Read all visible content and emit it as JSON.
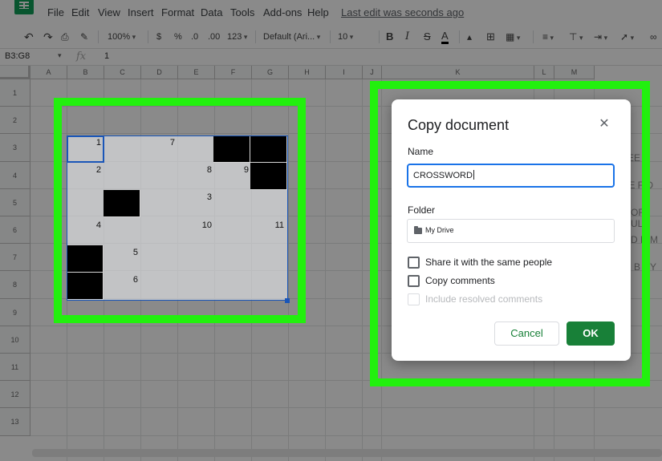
{
  "menubar": {
    "items": [
      "File",
      "Edit",
      "View",
      "Insert",
      "Format",
      "Data",
      "Tools",
      "Add-ons",
      "Help"
    ],
    "last_edit": "Last edit was seconds ago"
  },
  "toolbar": {
    "zoom": "100%",
    "currency": "$",
    "percent": "%",
    "decrease_decimals": ".0",
    "increase_decimals": ".00",
    "more_formats": "123",
    "font": "Default (Ari...",
    "font_size": "10",
    "bold": "B",
    "italic": "I",
    "strikethrough": "S",
    "text_color": "A"
  },
  "formula_bar": {
    "cell_range": "B3:G8",
    "fx": "fx",
    "value": "1"
  },
  "grid": {
    "columns": [
      "A",
      "B",
      "C",
      "D",
      "E",
      "F",
      "G",
      "H",
      "I",
      "J",
      "K",
      "L",
      "M"
    ],
    "rows": [
      "1",
      "2",
      "3",
      "4",
      "5",
      "6",
      "7",
      "8",
      "9",
      "10",
      "11",
      "12",
      "13"
    ]
  },
  "crossword": {
    "numbers": [
      "1",
      "7",
      "2",
      "8",
      "9",
      "3",
      "4",
      "10",
      "11",
      "5",
      "6"
    ]
  },
  "background_text": [
    "EE",
    "TE F D",
    "OR ULL",
    "D NIM",
    "B DY"
  ],
  "dialog": {
    "title": "Copy document",
    "name_label": "Name",
    "name_value": "CROSSWORD",
    "folder_label": "Folder",
    "folder_value": "My Drive",
    "share_label": "Share it with the same people",
    "copy_comments_label": "Copy comments",
    "include_resolved_label": "Include resolved comments",
    "cancel_label": "Cancel",
    "ok_label": "OK",
    "accent_color": "#188038",
    "focus_color": "#1a73e8"
  }
}
